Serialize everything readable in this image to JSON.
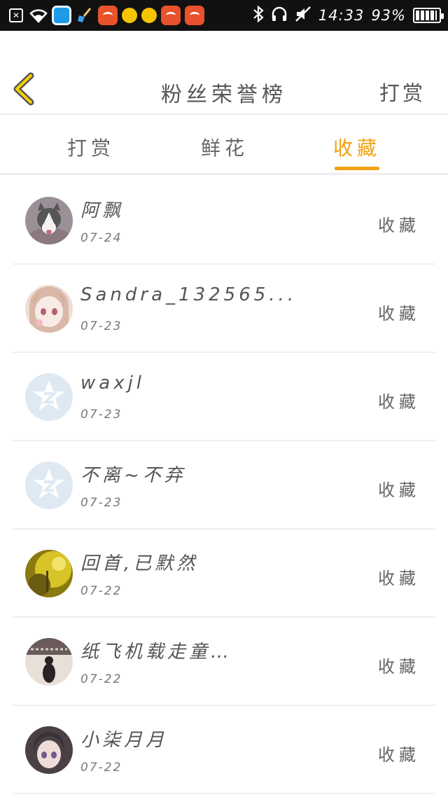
{
  "status_bar": {
    "time": "14:33",
    "battery": "93%",
    "battery_level": 0.93
  },
  "header": {
    "title": "粉丝荣誉榜",
    "action_label": "打赏"
  },
  "tabs": [
    {
      "label": "打赏",
      "active": false
    },
    {
      "label": "鲜花",
      "active": false
    },
    {
      "label": "收藏",
      "active": true
    }
  ],
  "accent_color": "#f4a013",
  "fans": [
    {
      "name": "阿飘",
      "date": "07-24",
      "gift": "收藏",
      "avatar": "husky-dog"
    },
    {
      "name": "Sandra_132565...",
      "date": "07-23",
      "gift": "收藏",
      "avatar": "anime-girl"
    },
    {
      "name": "waxjl",
      "date": "07-23",
      "gift": "收藏",
      "avatar": "default-star"
    },
    {
      "name": "不离~不弃",
      "date": "07-23",
      "gift": "收藏",
      "avatar": "default-star"
    },
    {
      "name": "回首,已默然",
      "date": "07-22",
      "gift": "收藏",
      "avatar": "yellow-scene"
    },
    {
      "name": "纸飞机载走童…",
      "date": "07-22",
      "gift": "收藏",
      "avatar": "photo-text"
    },
    {
      "name": "小柒月月",
      "date": "07-22",
      "gift": "收藏",
      "avatar": "dark-anime"
    }
  ]
}
